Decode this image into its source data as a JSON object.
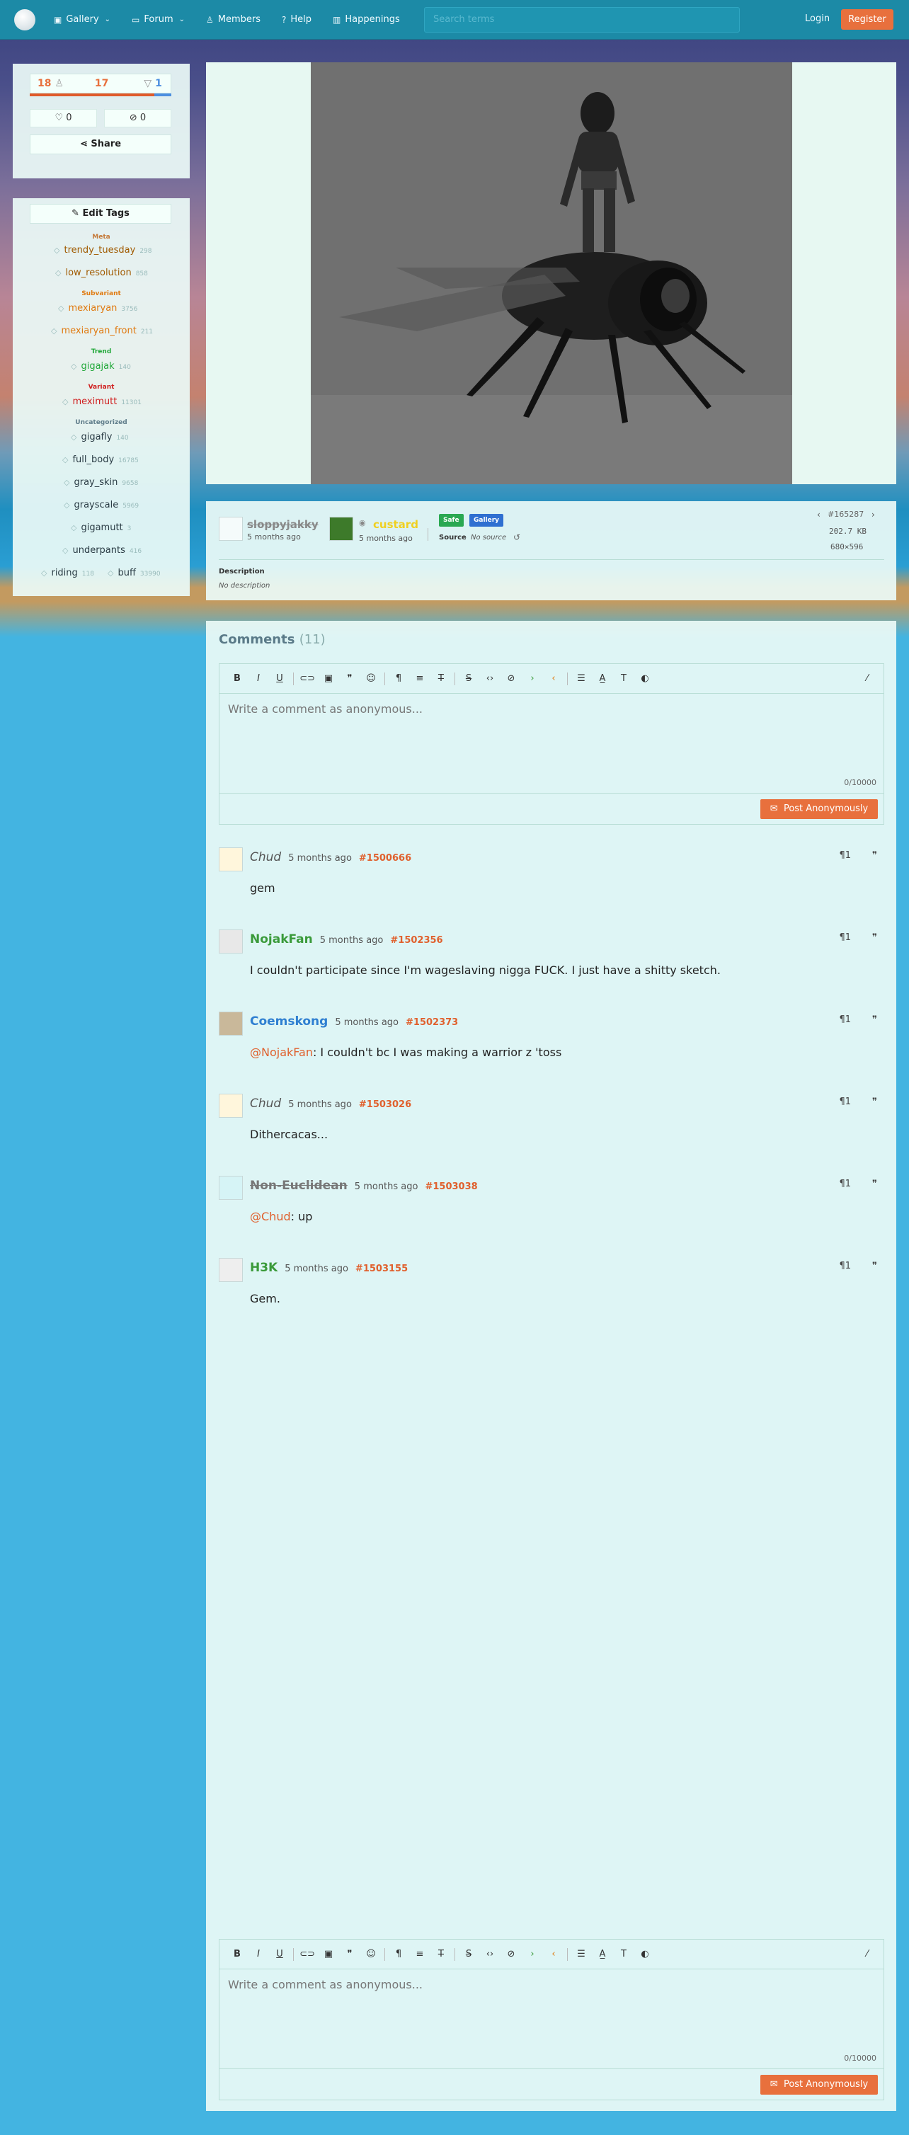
{
  "nav": {
    "gallery": "Gallery",
    "forum": "Forum",
    "members": "Members",
    "help": "Help",
    "happenings": "Happenings",
    "search_placeholder": "Search terms",
    "login": "Login",
    "register": "Register"
  },
  "votes": {
    "up": "18",
    "score": "17",
    "down": "1",
    "favorites": "0",
    "hides": "0",
    "share": "Share"
  },
  "tags": {
    "edit_label": "Edit Tags",
    "categories": {
      "meta": "Meta",
      "subvariant": "Subvariant",
      "trend": "Trend",
      "variant": "Variant",
      "uncategorized": "Uncategorized"
    },
    "items": [
      {
        "name": "trendy_tuesday",
        "count": "298",
        "color": "#a05a00"
      },
      {
        "name": "low_resolution",
        "count": "858",
        "color": "#a05a00"
      },
      {
        "name": "mexiaryan",
        "count": "3756",
        "color": "#e07a10"
      },
      {
        "name": "mexiaryan_front",
        "count": "211",
        "color": "#e07a10"
      },
      {
        "name": "gigajak",
        "count": "140",
        "color": "#22a83a"
      },
      {
        "name": "meximutt",
        "count": "11301",
        "color": "#d02020"
      },
      {
        "name": "gigafly",
        "count": "140",
        "color": "#333333"
      },
      {
        "name": "full_body",
        "count": "16785",
        "color": "#333333"
      },
      {
        "name": "gray_skin",
        "count": "9658",
        "color": "#333333"
      },
      {
        "name": "grayscale",
        "count": "5969",
        "color": "#333333"
      },
      {
        "name": "gigamutt",
        "count": "3",
        "color": "#333333"
      },
      {
        "name": "underpants",
        "count": "416",
        "color": "#333333"
      },
      {
        "name": "riding",
        "count": "118",
        "color": "#333333"
      },
      {
        "name": "buff",
        "count": "33990",
        "color": "#333333"
      }
    ]
  },
  "info": {
    "uploader": "sloppyjakky",
    "uploader_time": "5 months ago",
    "approver": "custard",
    "approver_time": "5 months ago",
    "badge_safe": "Safe",
    "badge_gallery": "Gallery",
    "source_label": "Source",
    "source_value": "No source",
    "post_id": "#165287",
    "size": "202.7 KB",
    "dims": "680×596",
    "description_label": "Description",
    "description_value": "No description"
  },
  "comments": {
    "title": "Comments",
    "count": "(11)",
    "placeholder": "Write a comment as anonymous...",
    "counter": "0/10000",
    "post_button": "Post Anonymously",
    "items": [
      {
        "name": "Chud",
        "time": "5 months ago",
        "id": "#1500666",
        "body": "gem",
        "mention": "",
        "name_color": "#555555",
        "italic": true
      },
      {
        "name": "NojakFan",
        "time": "5 months ago",
        "id": "#1502356",
        "body": "I couldn't participate since I'm wageslaving nigga FUCK. I just have a shitty sketch.",
        "mention": "",
        "name_color": "#3a9a3a",
        "italic": false
      },
      {
        "name": "Coemskong",
        "time": "5 months ago",
        "id": "#1502373",
        "body": ": I couldn't bc I was making a warrior z 'toss",
        "mention": "@NojakFan",
        "name_color": "#2f7fd1",
        "italic": false
      },
      {
        "name": "Chud",
        "time": "5 months ago",
        "id": "#1503026",
        "body": "Dithercacas...",
        "mention": "",
        "name_color": "#555555",
        "italic": true
      },
      {
        "name": "Non-Euclidean",
        "time": "5 months ago",
        "id": "#1503038",
        "body": ": up",
        "mention": "@Chud",
        "name_color": "#777777",
        "italic": false
      },
      {
        "name": "H3K",
        "time": "5 months ago",
        "id": "#1503155",
        "body": "Gem.",
        "mention": "",
        "name_color": "#3a9a3a",
        "italic": false
      }
    ]
  },
  "icons": {
    "gallery": "image-icon",
    "forum": "chat-icon",
    "members": "user-icon",
    "help": "question-icon",
    "happenings": "book-icon",
    "upvote": "thumbs-up-icon",
    "downvote": "thumbs-down-icon",
    "fave": "heart-icon",
    "hide": "eye-slash-icon",
    "share": "share-icon",
    "edit": "pencil-icon",
    "tag": "tag-icon",
    "link": "link-icon",
    "quote": "quote-icon"
  }
}
